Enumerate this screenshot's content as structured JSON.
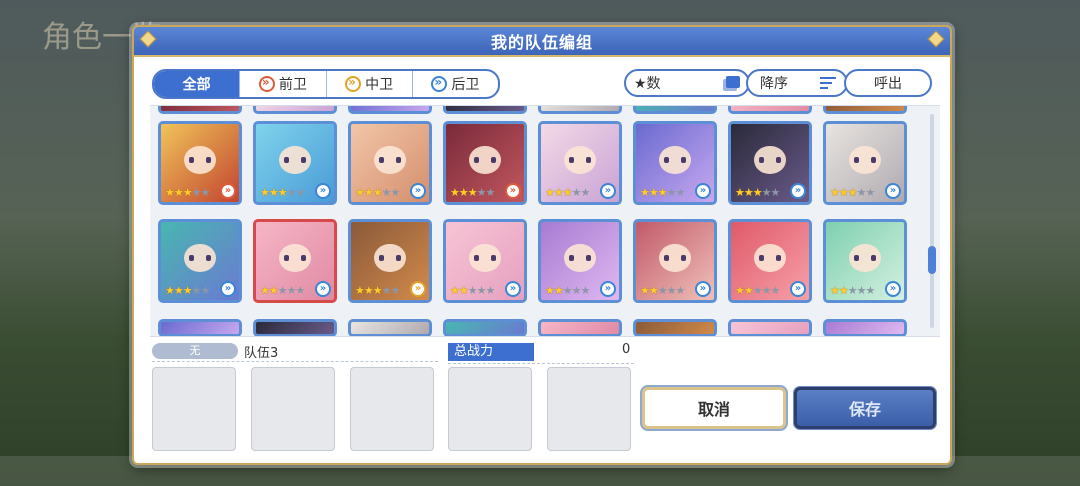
{
  "background": {
    "title": "角色一览"
  },
  "dialog": {
    "title": "我的队伍编组",
    "filters": [
      {
        "label": "全部",
        "icon": "",
        "active": true
      },
      {
        "label": "前卫",
        "icon": "front-position-icon",
        "active": false
      },
      {
        "label": "中卫",
        "icon": "middle-position-icon",
        "active": false
      },
      {
        "label": "后卫",
        "icon": "back-position-icon",
        "active": false
      }
    ],
    "sort_label": "★数",
    "order_label": "降序",
    "call_label": "呼出",
    "characters_row1": [
      {
        "stars": 3,
        "position": "front"
      },
      {
        "stars": 3,
        "position": "back"
      },
      {
        "stars": 3,
        "position": "back"
      },
      {
        "stars": 3,
        "position": "front"
      },
      {
        "stars": 3,
        "position": "back"
      },
      {
        "stars": 3,
        "position": "back"
      },
      {
        "stars": 3,
        "position": "back"
      },
      {
        "stars": 3,
        "position": "back"
      }
    ],
    "characters_row2": [
      {
        "stars": 3,
        "position": "back"
      },
      {
        "stars": 2,
        "position": "back"
      },
      {
        "stars": 3,
        "position": "middle"
      },
      {
        "stars": 2,
        "position": "back"
      },
      {
        "stars": 2,
        "position": "back"
      },
      {
        "stars": 2,
        "position": "back"
      },
      {
        "stars": 2,
        "position": "back"
      },
      {
        "stars": 2,
        "position": "back"
      }
    ],
    "team": {
      "tag": "无",
      "name": "队伍3",
      "power_label": "总战力",
      "power_value": "0"
    },
    "cancel_label": "取消",
    "save_label": "保存",
    "colors": {
      "accent": "#3d6fd0",
      "gold": "#d8b76a",
      "star": "#ffcc2e"
    }
  }
}
